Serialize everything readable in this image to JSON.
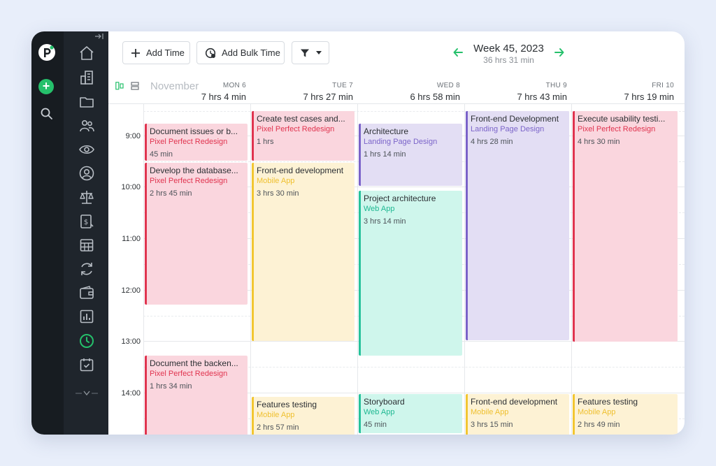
{
  "toolbar": {
    "add_time": "Add Time",
    "add_bulk_time": "Add Bulk Time"
  },
  "week": {
    "title": "Week 45, 2023",
    "total": "36 hrs 31 min"
  },
  "calendar": {
    "month": "November",
    "days": [
      {
        "label": "MON 6",
        "hours": "7 hrs 4 min"
      },
      {
        "label": "TUE 7",
        "hours": "7 hrs 27 min"
      },
      {
        "label": "WED 8",
        "hours": "6 hrs 58 min"
      },
      {
        "label": "THU 9",
        "hours": "7 hrs 43 min"
      },
      {
        "label": "FRI 10",
        "hours": "7 hrs 19 min"
      }
    ],
    "times": [
      "9:00",
      "10:00",
      "11:00",
      "12:00",
      "13:00",
      "14:00"
    ],
    "events": [
      {
        "title": "Document issues or b...",
        "project": "Pixel Perfect Redesign",
        "duration": "45 min",
        "color": "pink"
      },
      {
        "title": "Develop the database...",
        "project": "Pixel Perfect Redesign",
        "duration": "2 hrs 45 min",
        "color": "pink"
      },
      {
        "title": "Document the backen...",
        "project": "Pixel Perfect Redesign",
        "duration": "1 hrs 34 min",
        "color": "pink"
      },
      {
        "title": "Create test cases and...",
        "project": "Pixel Perfect Redesign",
        "duration": "1 hrs",
        "color": "pink"
      },
      {
        "title": "Front-end development",
        "project": "Mobile App",
        "duration": "3 hrs 30 min",
        "color": "yellow"
      },
      {
        "title": "Features testing",
        "project": "Mobile App",
        "duration": "2 hrs 57 min",
        "color": "yellow"
      },
      {
        "title": "Architecture",
        "project": "Landing Page Design",
        "duration": "1 hrs 14 min",
        "color": "purple"
      },
      {
        "title": "Project architecture",
        "project": "Web App",
        "duration": "3 hrs 14 min",
        "color": "teal"
      },
      {
        "title": "Storyboard",
        "project": "Web App",
        "duration": "45 min",
        "color": "teal"
      },
      {
        "title": "Front-end Development",
        "project": "Landing Page Design",
        "duration": "4 hrs 28 min",
        "color": "purple"
      },
      {
        "title": "Front-end development",
        "project": "Mobile App",
        "duration": "3 hrs 15 min",
        "color": "yellow"
      },
      {
        "title": "Execute usability testi...",
        "project": "Pixel Perfect Redesign",
        "duration": "4 hrs 30 min",
        "color": "pink"
      },
      {
        "title": "Features testing",
        "project": "Mobile App",
        "duration": "2 hrs 49 min",
        "color": "yellow"
      }
    ]
  },
  "colors": {
    "accent_green": "#25c06b",
    "pink": "#e0344f",
    "yellow": "#f2c631",
    "purple": "#7a62c9",
    "teal": "#26c29b"
  },
  "icons": {
    "rail": [
      "logo-icon",
      "plus-icon",
      "search-icon"
    ],
    "sidebar": [
      "home-icon",
      "building-icon",
      "folder-icon",
      "users-icon",
      "eye-icon",
      "user-circle-icon",
      "scale-icon",
      "invoice-icon",
      "table-icon",
      "refresh-icon",
      "wallet-icon",
      "report-icon",
      "clock-icon",
      "calendar-check-icon",
      "chevron-down-icon"
    ]
  }
}
